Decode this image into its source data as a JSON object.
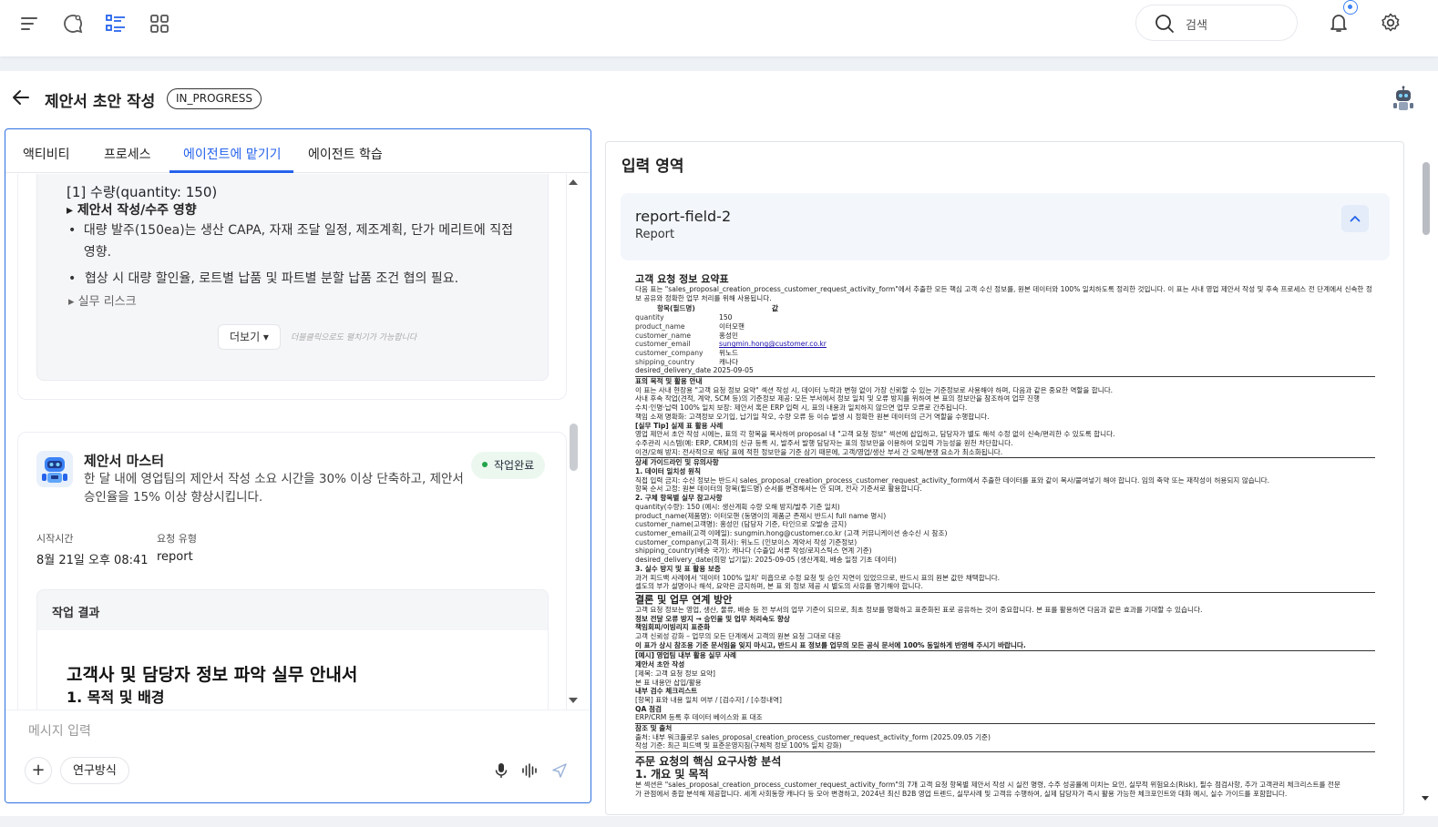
{
  "search": {
    "placeholder": "검색"
  },
  "page": {
    "title": "제안서 초안 작성",
    "status": "IN_PROGRESS"
  },
  "tabs": [
    {
      "label": "액티비티"
    },
    {
      "label": "프로세스"
    },
    {
      "label": "에이전트에 맡기기"
    },
    {
      "label": "에이전트 학습"
    }
  ],
  "card1": {
    "heading": "[1] 수량(quantity: 150)",
    "sub": "▸ 제안서 작성/수주 영향",
    "bullets": [
      "대량 발주(150ea)는 생산 CAPA, 자재 조달 일정, 제조계획, 단가 메리트에 직접 영향.",
      "협상 시 대량 할인율, 로트별 납품 및 파트별 분할 납품 조건 협의 필요."
    ],
    "risk": "▸ 실무 리스크",
    "more": "더보기 ▾",
    "hint": "더블클릭으로도 펼치기가 가능합니다"
  },
  "card2": {
    "name": "제안서 마스터",
    "desc": "한 달 내에 영업팀의 제안서 작성 소요 시간을 30% 이상 단축하고, 제안서 승인율을 15% 이상 향상시킵니다.",
    "status": "작업완료",
    "start_label": "시작시간",
    "start_value": "8월 21일 오후 08:41",
    "type_label": "요청 유형",
    "type_value": "report",
    "result_label": "작업 결과",
    "result_title": "고객사 및 담당자 정보 파악 실무 안내서",
    "result_sub": "1. 목적 및 배경"
  },
  "composer": {
    "placeholder": "메시지 입력",
    "chip": "연구방식",
    "plus": "+"
  },
  "right": {
    "title": "입력 영역",
    "field_name": "report-field-2",
    "field_type": "Report"
  },
  "doc": {
    "title": "고객 요청 정보 요약표",
    "intro": "다음 표는 \"sales_proposal_creation_process_customer_request_activity_form\"에서 추출한 모든 핵심 고객 수신 정보를, 원본 데이터와 100% 일치하도록 정리한 것입니다. 이 표는 사내 영업 제안서 작성 및 후속 프로세스 전 단계에서 신속한 정보 공유와 정확한 업무 처리를 위해 사용됩니다.",
    "table_head": [
      "항목(필드명)",
      "값"
    ],
    "rows": [
      [
        "quantity",
        "150"
      ],
      [
        "product_name",
        "이터모핸"
      ],
      [
        "customer_name",
        "홍성민"
      ],
      [
        "customer_email",
        "sungmin.hong@customer.co.kr"
      ],
      [
        "customer_company",
        "위노드"
      ],
      [
        "shipping_country",
        "캐나다"
      ],
      [
        "desired_delivery_date",
        "2025-09-05"
      ]
    ],
    "s1": "표의 목적 및 활용 안내",
    "s1_lines": [
      "이 표는 사내 현장용 \"고객 요청 정보 요약\" 섹션 작성 시, 데이터 누락과 변형 없이 가장 신뢰할 수 있는 기준정보로 사용해야 하며, 다음과 같은 중요한 역할을 합니다.",
      "사내 후속 작업(견적, 계약, SCM 등)의 기준정보 제공: 모든 부서에서 정보 일치 및 오류 방지를 위하여 본 표의 정보만을 참조하여 업무 진행",
      "수치·인명·납력 100% 일치 보장: 제안서 혹은 ERP 입력 시, 표의 내용과 일치하지 않으면 업무 오류로 간주됩니다.",
      "책임 소재 명확화: 고객정보 오기입, 납기일 착오, 수량 오류 등 이슈 발생 시 정확한 원본 데이터의 근거 역할을 수행합니다.",
      "[실무 Tip] 실제 표 활용 사례",
      "영업 제안서 초안 작성 시에는, 표의 각 항목을 복사하여 proposal 내 \"고객 요청 정보\" 섹션에 삽입하고, 담당자가 별도 해석 수정 없이 신속/편리한 수 있도록 합니다.",
      "수주관리 시스템(예: ERP, CRM)의 신규 등록 시, 발주서 발행 담당자는 표의 정보만을 이용하여 오입력 가능성을 원천 차단합니다.",
      "이견/오해 방지: 전사적으로 해당 표에 적힌 정보만을 기준 삼기 때문에, 고객/영업/생산 부서 간 오해/분쟁 요소가 최소화됩니다."
    ],
    "s2": "상세 가이드라인 및 유의사항",
    "s2_lines": [
      "1. 데이터 일치성 원칙",
      "직접 입력 금지: 수신 정보는 반드시 sales_proposal_creation_process_customer_request_activity_form에서 추출한 데이터를 표와 같이 복사/붙여넣기 해야 합니다. 임의 축약 또는 재작성이 허용되지 않습니다.",
      "항목 순서 고정: 원본 데이터의 항목(필드명) 순서를 변경해서는 안 되며, 전사 기준서로 활용합니다.",
      "2. 구체 항목별 실무 참고사항",
      "quantity(수량): 150 (예시: 생산계획 수량 오해 방지/발주 기준 일치)",
      "product_name(제품명): 이터모핸 (동명이의 제품군 존재시 반드시 full name 명시)",
      "customer_name(고객명): 홍성민 (담당자 기준, 타인으로 오발송 금지)",
      "customer_email(고객 이메일): sungmin.hong@customer.co.kr (고객 커뮤니케이션 송수신 시 참조)",
      "customer_company(고객 회사): 위노드 (인보이스 계약서 작성 기준정보)",
      "shipping_country(배송 국가): 캐나다 (수출입 서류 작성/로지스틱스 연계 기준)",
      "desired_delivery_date(희망 납기일): 2025-09-05 (생산계획, 배송 일정 기초 데이터)",
      "3. 실수 방지 및 표 활용 보증",
      "과거 피드백 사례에서 '데이터 100% 일치' 미흡으로 수정 요청 및 승인 지연이 있었으므로, 반드시 표의 원본 값만 채택합니다.",
      "셀도의 부가 설명이나 해석, 요약은 금지하며, 본 표 외 정보 제공 시 별도의 사유를 명기해야 합니다."
    ],
    "s3": "결론 및 업무 연계 방안",
    "s3_lines": [
      "고객 요청 정보는 영업, 생산, 물류, 배송 등 전 부서의 업무 기준이 되므로, 최초 정보를 명확하고 표준화된 표로 공유하는 것이 중요합니다. 본 표를 활용하면 다음과 같은 효과를 기대할 수 있습니다.",
      "정보 전달 오류 방지 → 승인율 및 업무 처리속도 향상",
      "책임회피/이빙리지 표준화",
      "고객 신뢰성 강화 – 업무의 모든 단계에서 고객의 원본 요청 그대로 대응",
      "이 표가 상시 참조용 기준 문서임을 잊지 마시고, 반드시 표 정보를 업무의 모든 공식 문서에 100% 동일하게 반영해 주시기 바랍니다."
    ],
    "s4": "[예시] 영업팀 내부 활용 실무 사례",
    "s4_lines": [
      "제안서 초안 작성",
      "[제목: 고객 요청 정보 요약]",
      "본 표 내용만 삽입/활용",
      "내부 검수 체크리스트",
      "[항목] 표와 내용 일치 여부 / [검수자] / [수정내역]",
      "QA 점검",
      "ERP/CRM 등록 후 데이터 베이스와 표 대조"
    ],
    "s5": "참조 및 출처",
    "s5_lines": [
      "출처: 내부 워크플로우 sales_proposal_creation_process_customer_request_activity_form (2025.09.05 기준)",
      "작성 기준: 최근 피드백 및 표준운영지침(구체적 정보 100% 일치 강화)"
    ],
    "s6": "주문 요청의 핵심 요구사항 분석",
    "s6_sub": "1. 개요 및 목적",
    "s6_lines": [
      "본 섹션은 \"sales_proposal_creation_process_customer_request_activity_form\"의 7개 고객 요청 항목별 제안서 작성 시 실전 명령, 수주 성공률에 미치는 요인, 실무적 위험요소(Risk), 필수 점검사항, 추가 고객관리 체크리스트를 전문",
      "가 관점에서 종합 분석해 제공합니다. 세계 사회동향 캐나다 등 모아 변경하고, 2024년 최신 B2B 영업 트렌드, 실무사례 및 고객유 수행하여, 실제 담당자가 즉시 활용 가능한 체크포인트와 대화 예시, 실수 가이드를 포함합니다."
    ]
  }
}
